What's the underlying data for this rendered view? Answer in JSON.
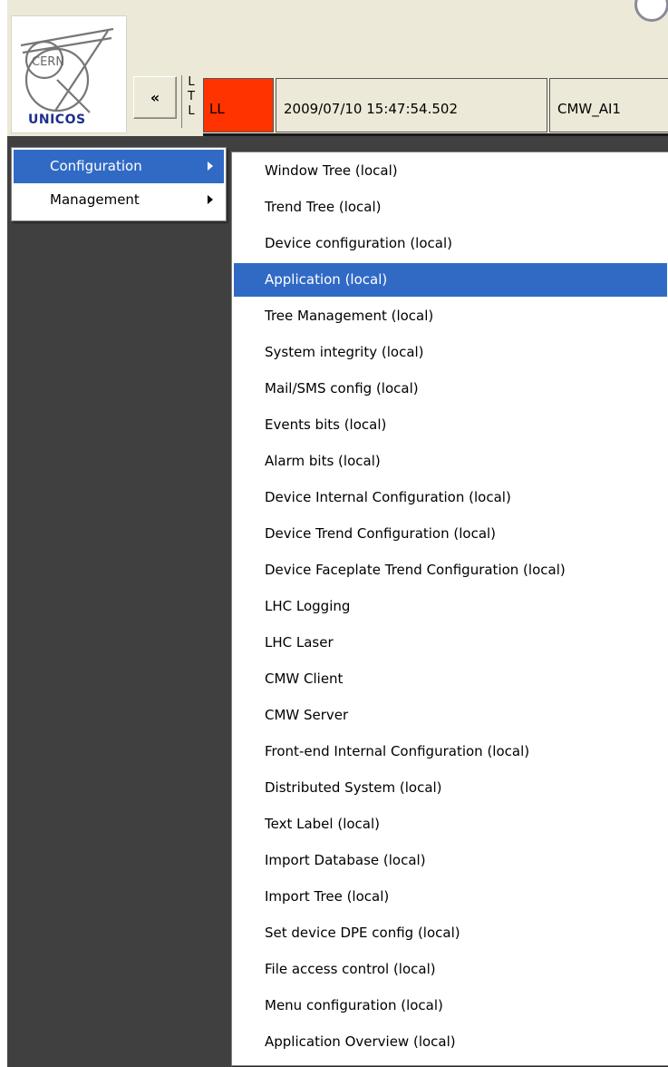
{
  "header": {
    "logo_top": "CERN",
    "logo_bottom": "UNICOS",
    "collapse_label": "«",
    "ltl_letters": [
      "L",
      "T",
      "L"
    ],
    "alarm_text": "LL",
    "timestamp": "2009/07/10 15:47:54.502",
    "source": "CMW_AI1"
  },
  "colors": {
    "alarm": "#ff3300",
    "selection": "#316ac5",
    "panel": "#404040",
    "chrome": "#ece9d8"
  },
  "main_menu": {
    "items": [
      {
        "label": "Configuration",
        "selected": true,
        "submenu": true
      },
      {
        "label": "Management",
        "selected": false,
        "submenu": true
      }
    ]
  },
  "submenu": {
    "items": [
      {
        "label": "Window Tree (local)"
      },
      {
        "label": "Trend Tree (local)"
      },
      {
        "label": "Device configuration (local)"
      },
      {
        "label": "Application (local)",
        "selected": true
      },
      {
        "label": "Tree Management (local)"
      },
      {
        "label": "System integrity (local)"
      },
      {
        "label": "Mail/SMS config (local)"
      },
      {
        "label": "Events bits (local)"
      },
      {
        "label": "Alarm bits (local)"
      },
      {
        "label": "Device Internal Configuration (local)"
      },
      {
        "label": "Device Trend Configuration (local)"
      },
      {
        "label": "Device Faceplate Trend Configuration (local)"
      },
      {
        "label": "LHC Logging"
      },
      {
        "label": "LHC Laser"
      },
      {
        "label": "CMW Client"
      },
      {
        "label": "CMW Server"
      },
      {
        "label": "Front-end Internal Configuration (local)"
      },
      {
        "label": "Distributed System (local)"
      },
      {
        "label": "Text Label (local)"
      },
      {
        "label": "Import Database (local)"
      },
      {
        "label": "Import Tree (local)"
      },
      {
        "label": "Set device DPE config (local)"
      },
      {
        "label": "File access control (local)"
      },
      {
        "label": "Menu configuration (local)"
      },
      {
        "label": "Application Overview (local)"
      }
    ]
  }
}
